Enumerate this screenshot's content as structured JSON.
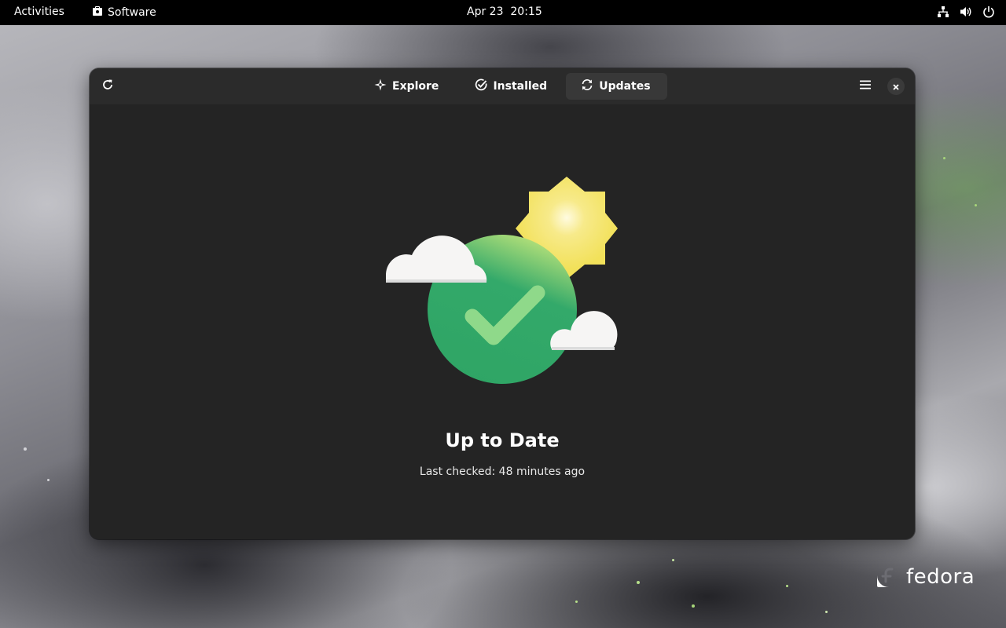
{
  "topbar": {
    "activities_label": "Activities",
    "app_menu_label": "Software",
    "clock": "Apr 23  20:15",
    "tray_icons": [
      "network-wired-icon",
      "volume-icon",
      "power-icon"
    ]
  },
  "window": {
    "headerbar": {
      "refresh_icon": "refresh-icon",
      "menu_icon": "hamburger-menu-icon",
      "close_icon": "close-icon",
      "tabs": [
        {
          "label": "Explore",
          "icon": "sparkle-icon",
          "active": false
        },
        {
          "label": "Installed",
          "icon": "check-circle-icon",
          "active": false
        },
        {
          "label": "Updates",
          "icon": "sync-icon",
          "active": true
        }
      ]
    },
    "status": {
      "title": "Up to Date",
      "subtitle": "Last checked: 48 minutes ago"
    }
  },
  "desktop": {
    "logo_text": "fedora"
  },
  "colors": {
    "window_bg": "#242424",
    "headerbar_bg": "#2b2b2b",
    "active_tab_bg": "#383838",
    "globe_green": "#33a96a",
    "check_green": "#8fd98a",
    "sun_yellow": "#f2e15a",
    "cloud_white": "#f6f5f4"
  }
}
